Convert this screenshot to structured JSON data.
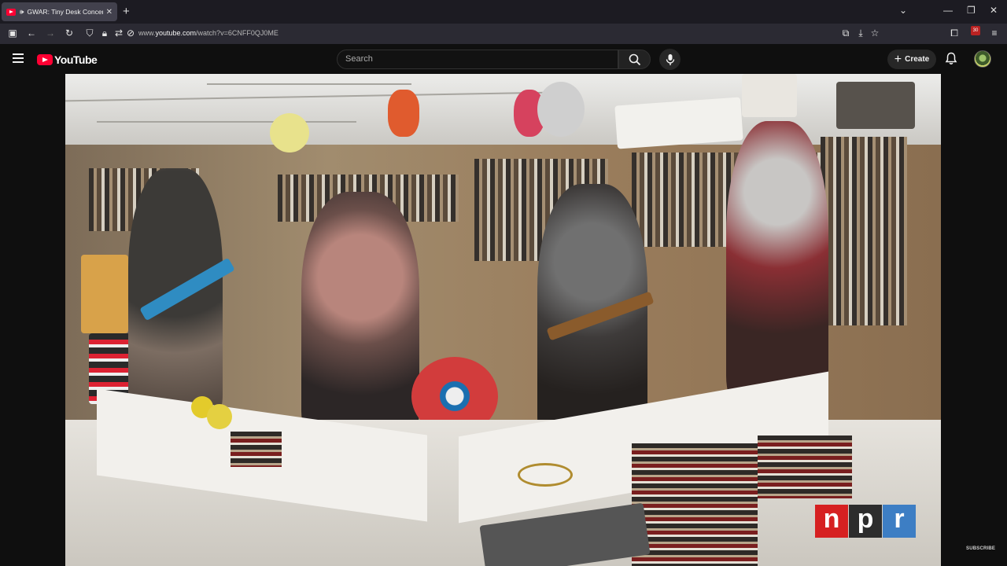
{
  "browser": {
    "tab": {
      "title": "GWAR: Tiny Desk Concert"
    },
    "new_tab": "+",
    "url_prefix": "www.",
    "url_domain": "youtube.com",
    "url_path": "/watch?v=6CNFF0QJ0ME",
    "extension_badge": "30"
  },
  "youtube": {
    "logo_text": "YouTube",
    "search_placeholder": "Search",
    "create_label": "Create"
  },
  "video": {
    "watermark_letters": [
      "n",
      "p",
      "r"
    ],
    "watermark_colors": [
      "#d62021",
      "#2d2d2d",
      "#3d7ec4"
    ],
    "subscribe_label": "SUBSCRIBE"
  }
}
